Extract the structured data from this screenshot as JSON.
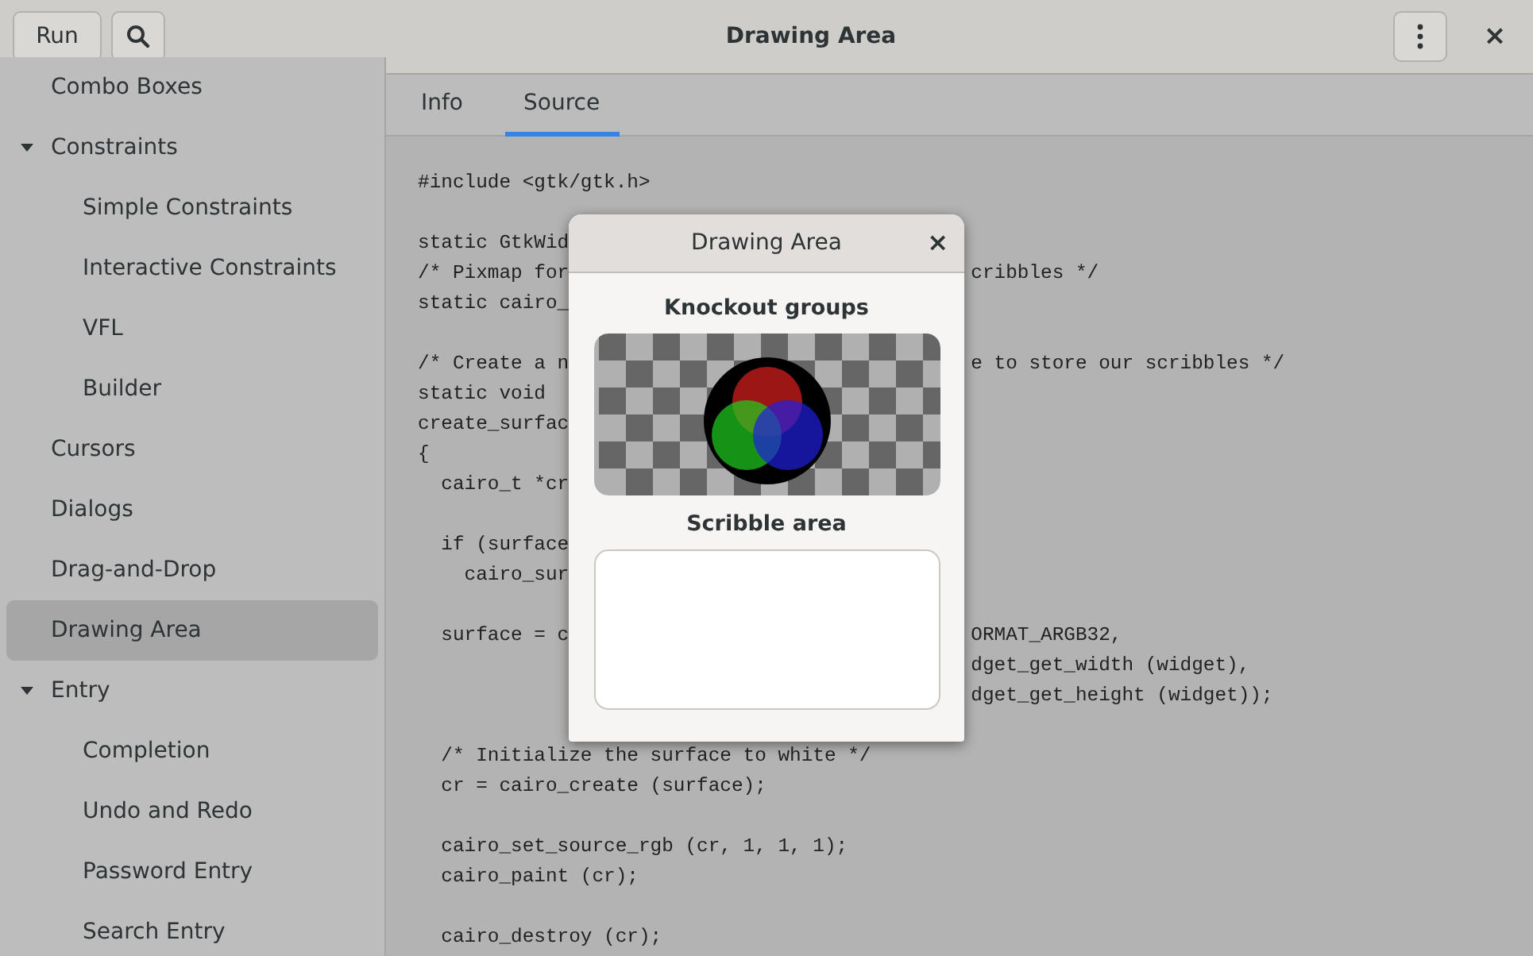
{
  "header": {
    "run_button": "Run",
    "title": "Drawing Area",
    "close": "×"
  },
  "sidebar": {
    "items": [
      {
        "label": "Combo Boxes",
        "selected": false
      },
      {
        "label": "Constraints",
        "selected": false,
        "expanded": true,
        "children": [
          {
            "label": "Simple Constraints",
            "selected": false
          },
          {
            "label": "Interactive Constraints",
            "selected": false
          },
          {
            "label": "VFL",
            "selected": false
          },
          {
            "label": "Builder",
            "selected": false
          }
        ]
      },
      {
        "label": "Cursors",
        "selected": false
      },
      {
        "label": "Dialogs",
        "selected": false
      },
      {
        "label": "Drag-and-Drop",
        "selected": false
      },
      {
        "label": "Drawing Area",
        "selected": true
      },
      {
        "label": "Entry",
        "selected": false,
        "expanded": true,
        "children": [
          {
            "label": "Completion",
            "selected": false
          },
          {
            "label": "Undo and Redo",
            "selected": false
          },
          {
            "label": "Password Entry",
            "selected": false
          },
          {
            "label": "Search Entry",
            "selected": false
          }
        ]
      }
    ]
  },
  "tabs": [
    {
      "label": "Info",
      "selected": false
    },
    {
      "label": "Source",
      "selected": true
    }
  ],
  "source": [
    {
      "left": "#include <gtk/gtk.h>"
    },
    {
      "left": "static GtkWid",
      "blank_before": true
    },
    {
      "left": "/* Pixmap for",
      "right": "cribbles */"
    },
    {
      "left": "static cairo_"
    },
    {
      "left": "/* Create a n",
      "right": "e to store our scribbles */",
      "blank_before": true
    },
    {
      "left": "static void"
    },
    {
      "left": "create_surfac"
    },
    {
      "left": "{"
    },
    {
      "left": "  cairo_t *cr"
    },
    {
      "left": "  if (surface",
      "blank_before": true
    },
    {
      "left": "    cairo_sur"
    },
    {
      "left": "  surface = c",
      "right": "ORMAT_ARGB32,",
      "blank_before": true
    },
    {
      "right": "dget_get_width (widget),"
    },
    {
      "right": "dget_get_height (widget));"
    },
    {
      "left": "  /* Initialize the surface to white */",
      "blank_before": true
    },
    {
      "left": "  cr = cairo_create (surface);"
    },
    {
      "left": "  cairo_set_source_rgb (cr, 1, 1, 1);",
      "blank_before": true
    },
    {
      "left": "  cairo_paint (cr);"
    },
    {
      "left": "  cairo_destroy (cr);",
      "blank_before": true
    }
  ],
  "dialog": {
    "title": "Drawing Area",
    "close": "×",
    "knockout_label": "Knockout groups",
    "scribble_label": "Scribble area"
  }
}
